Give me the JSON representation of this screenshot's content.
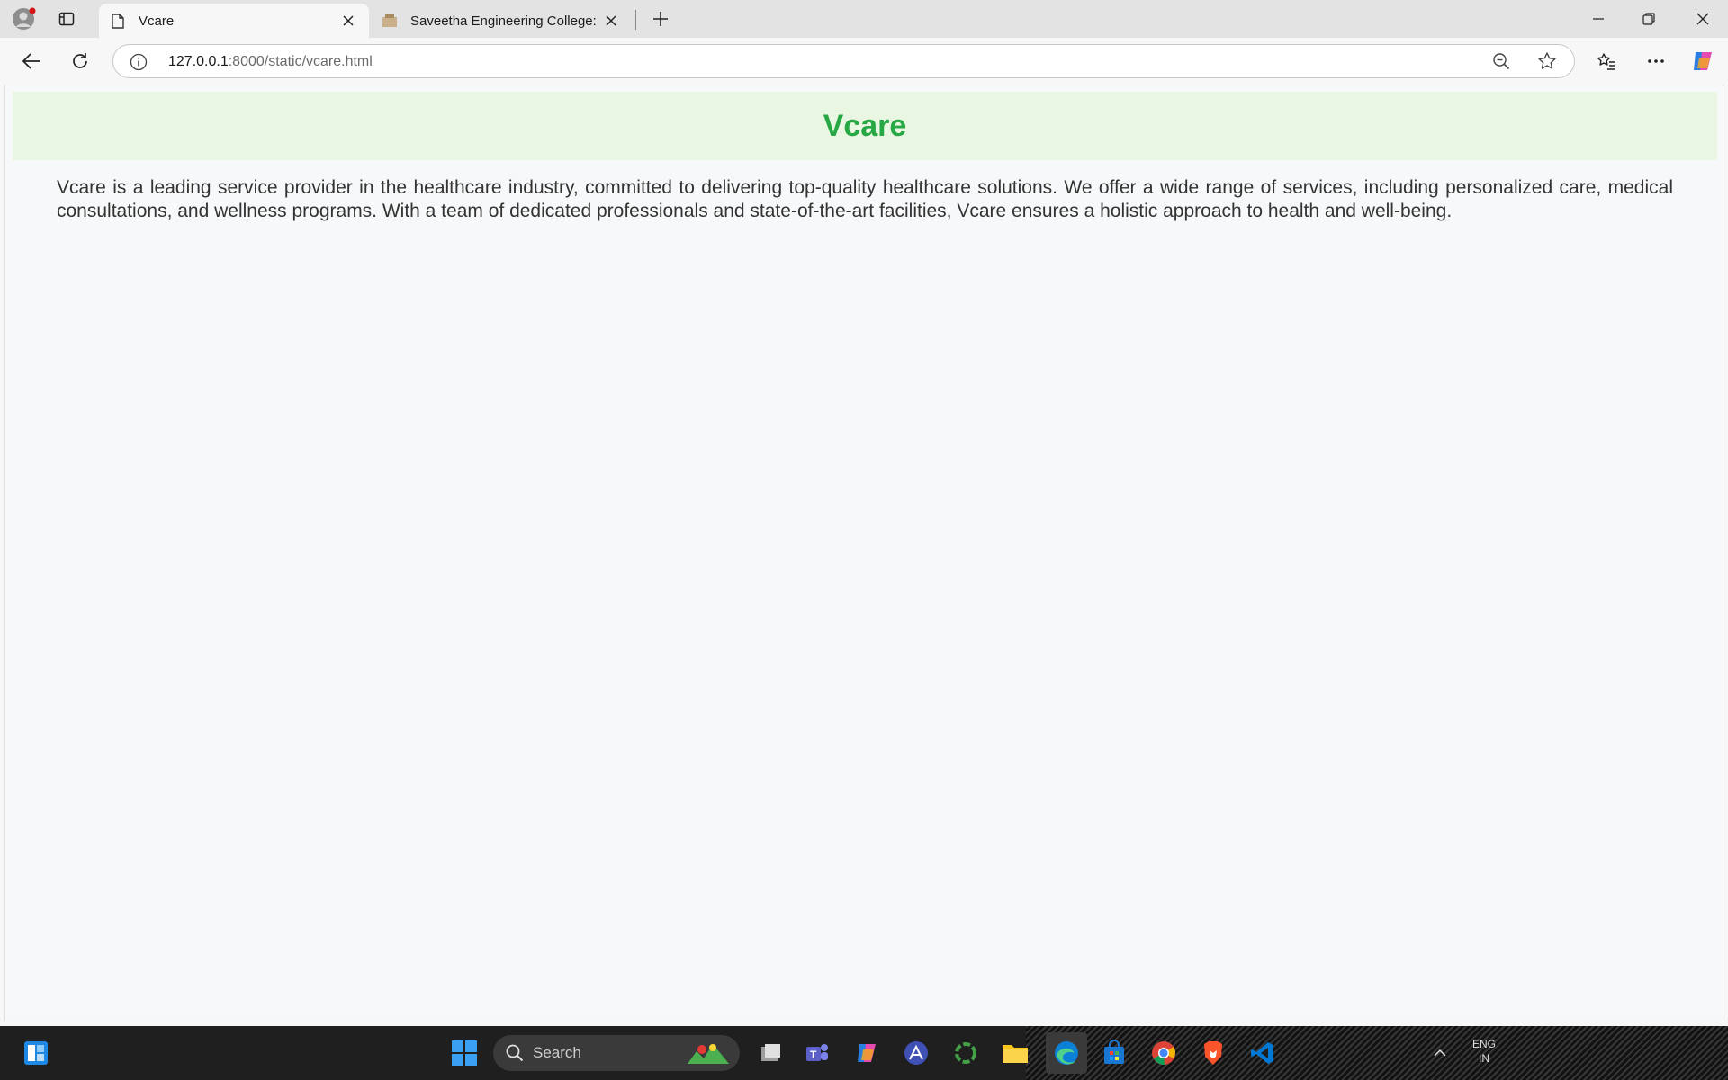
{
  "browser": {
    "tabs": [
      {
        "title": "Vcare",
        "active": true
      },
      {
        "title": "Saveetha Engineering College: Lo",
        "active": false
      }
    ],
    "address": {
      "host": "127.0.0.1",
      "rest": ":8000/static/vcare.html"
    }
  },
  "page": {
    "title": "Vcare",
    "description": "Vcare is a leading service provider in the healthcare industry, committed to delivering top-quality healthcare solutions. We offer a wide range of services, including personalized care, medical consultations, and wellness programs. With a team of dedicated professionals and state-of-the-art facilities, Vcare ensures a holistic approach to health and well-being."
  },
  "taskbar": {
    "search_label": "Search",
    "tray": {
      "lang": "ENG",
      "region": "IN"
    },
    "apps": [
      "task-view",
      "teams",
      "copilot",
      "app-a",
      "app-ring",
      "file-explorer",
      "edge",
      "store",
      "chrome",
      "brave",
      "vscode"
    ]
  },
  "colors": {
    "accent": "#28a745",
    "header_bg": "#e9f6e1"
  }
}
